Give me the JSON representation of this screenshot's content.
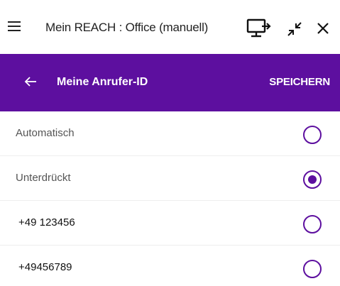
{
  "window": {
    "title": "Mein REACH : Office (manuell)",
    "icons": [
      "menu-icon",
      "screen-share-icon",
      "shrink-icon",
      "close-icon"
    ]
  },
  "header": {
    "title": "Meine Anrufer-ID",
    "save_label": "SPEICHERN",
    "back_icon": "arrow-left-icon"
  },
  "colors": {
    "accent": "#5d0f9f",
    "header_text": "#ffffff"
  },
  "options": [
    {
      "label": "Automatisch",
      "selected": false
    },
    {
      "label": "Unterdrückt",
      "selected": true
    },
    {
      "label": "+49 123456",
      "selected": false
    },
    {
      "label": "+49456789",
      "selected": false
    }
  ]
}
